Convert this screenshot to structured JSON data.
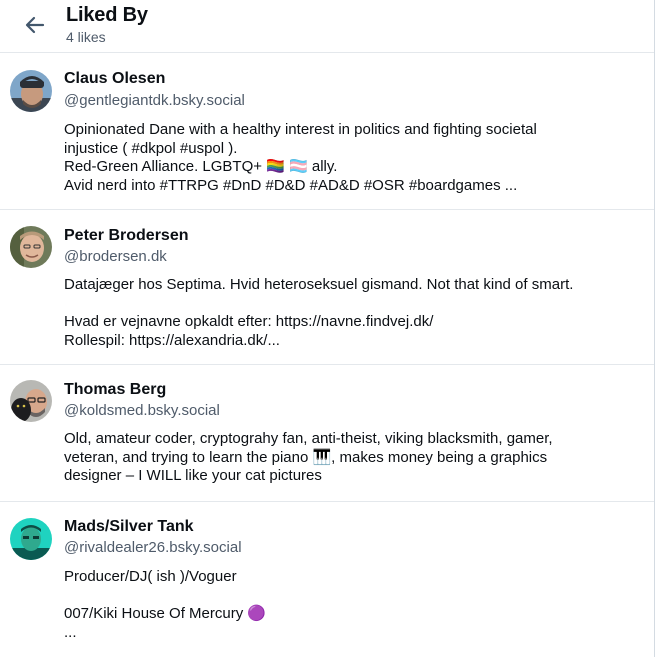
{
  "header": {
    "title": "Liked By",
    "count_label": "4 likes"
  },
  "users": [
    {
      "name": "Claus Olesen",
      "handle": "@gentlegiantdk.bsky.social",
      "bio_lines": [
        "Opinionated Dane with a healthy interest in politics and fighting societal",
        "injustice ( #dkpol #uspol ).",
        "Red-Green Alliance. LGBTQ+ 🏳️‍🌈 🏳️‍⚧️ ally.",
        "Avid nerd into #TTRPG #DnD #D&D #AD&D #OSR #boardgames ..."
      ]
    },
    {
      "name": "Peter Brodersen",
      "handle": "@brodersen.dk",
      "bio_lines": [
        "Datajæger hos Septima. Hvid heteroseksuel gismand. Not that kind of smart.",
        "",
        "Hvad er vejnavne opkaldt efter: https://navne.findvej.dk/",
        "Rollespil: https://alexandria.dk/..."
      ]
    },
    {
      "name": "Thomas Berg",
      "handle": "@koldsmed.bsky.social",
      "bio_lines": [
        "Old, amateur coder, cryptograhy fan, anti-theist, viking blacksmith, gamer,",
        "veteran, and trying to learn the piano 🎹, makes money being a graphics",
        "designer – I WILL like your cat pictures"
      ]
    },
    {
      "name": "Mads/Silver Tank",
      "handle": "@rivaldealer26.bsky.social",
      "bio_lines": [
        "Producer/DJ( ish )/Voguer",
        "",
        "007/Kiki House Of Mercury 🟣",
        "..."
      ]
    }
  ]
}
